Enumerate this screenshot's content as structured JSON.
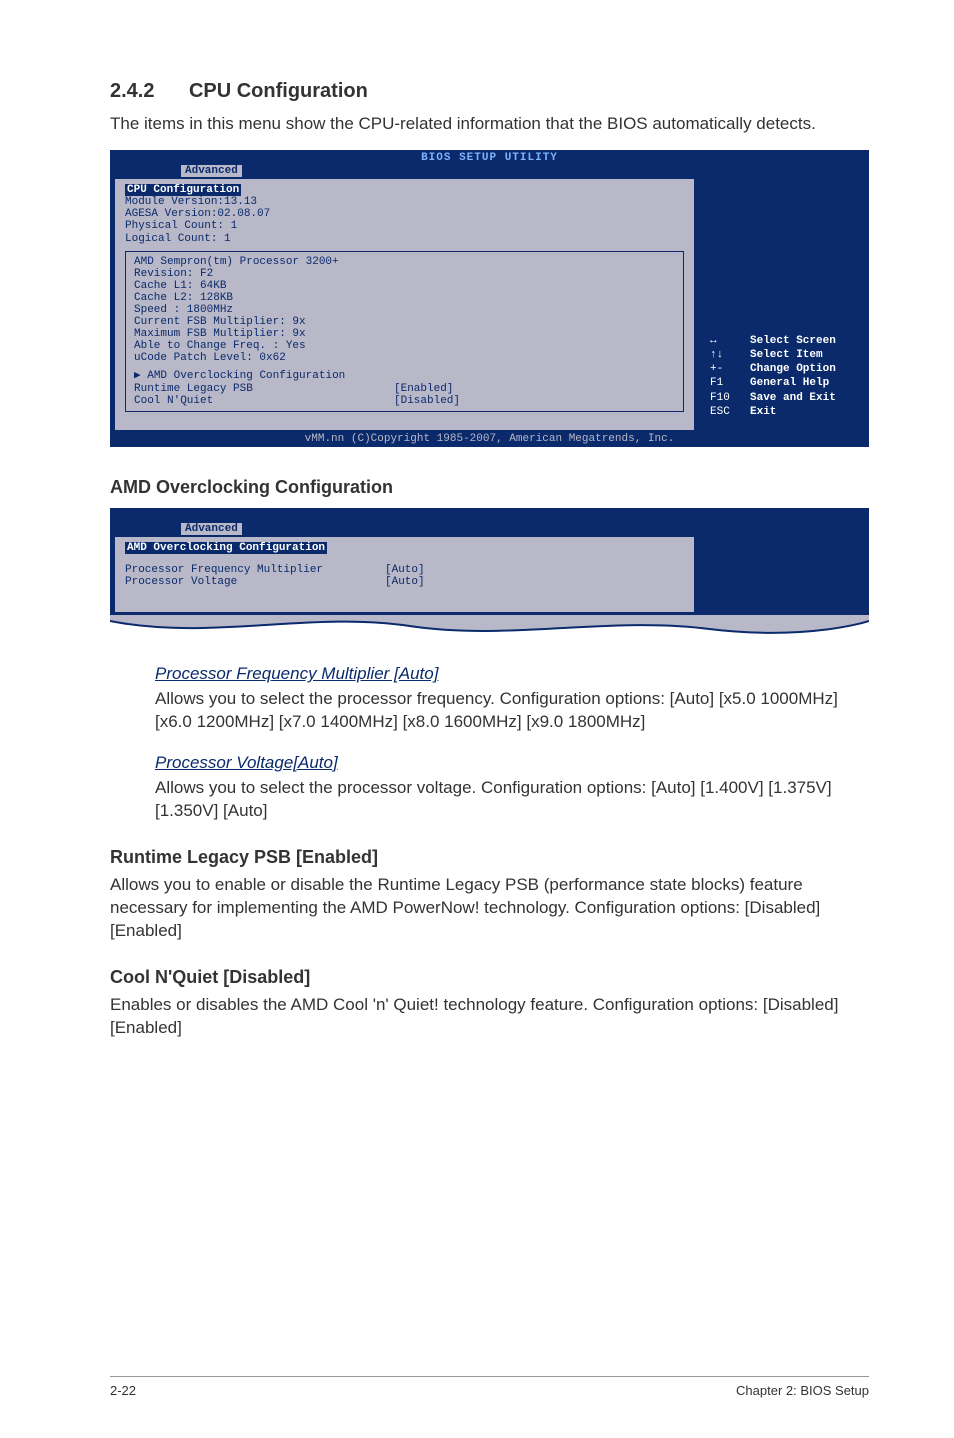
{
  "sectionNumber": "2.4.2",
  "sectionTitle": "CPU Configuration",
  "intro": "The items in this menu show the CPU-related information that the BIOS automatically detects.",
  "bios1": {
    "title": "BIOS SETUP UTILITY",
    "tab": "Advanced",
    "header": "CPU Configuration",
    "lines": [
      "Module Version:13.13",
      "AGESA Version:02.08.07",
      "Physical Count: 1",
      "Logical Count: 1"
    ],
    "sublines": [
      "AMD Sempron(tm) Processor 3200+",
      "Revision: F2",
      "Cache L1: 64KB",
      "Cache L2: 128KB",
      "Speed   : 1800MHz",
      "Current FSB Multiplier: 9x",
      "Maximum FSB Multiplier: 9x",
      "Able to Change Freq. : Yes",
      "uCode Patch Level: 0x62"
    ],
    "options": [
      {
        "label": "AMD Overclocking Configuration",
        "value": ""
      },
      {
        "label": "Runtime Legacy PSB",
        "value": "[Enabled]"
      },
      {
        "label": "Cool N'Quiet",
        "value": "[Disabled]"
      }
    ],
    "help": [
      {
        "key": "↔",
        "label": "Select Screen"
      },
      {
        "key": "↑↓",
        "label": "Select Item"
      },
      {
        "key": "+-",
        "label": "Change Option"
      },
      {
        "key": "F1",
        "label": "General Help"
      },
      {
        "key": "F10",
        "label": "Save and Exit"
      },
      {
        "key": "ESC",
        "label": "Exit"
      }
    ],
    "footer": "vMM.nn (C)Copyright 1985-2007, American Megatrends, Inc."
  },
  "amdHeading": "AMD Overclocking Configuration",
  "bios2": {
    "title": "BIOS SETUP UTILITY",
    "tab": "Advanced",
    "header": "AMD Overclocking Configuration",
    "rows": [
      {
        "label": "Processor Frequency Multiplier",
        "value": "[Auto]"
      },
      {
        "label": "Processor Voltage",
        "value": "[Auto]"
      }
    ]
  },
  "opt1": {
    "title": "Processor Frequency Multiplier [Auto]",
    "body": "Allows you to select the processor frequency. Configuration options: [Auto] [x5.0 1000MHz] [x6.0 1200MHz] [x7.0 1400MHz] [x8.0 1600MHz] [x9.0 1800MHz]"
  },
  "opt2": {
    "title": "Processor Voltage[Auto]",
    "body": "Allows you to select the processor voltage. Configuration options: [Auto] [1.400V] [1.375V] [1.350V] [Auto]"
  },
  "runtime": {
    "title": "Runtime Legacy PSB [Enabled]",
    "body": "Allows you to enable or disable the Runtime Legacy PSB (performance state blocks) feature necessary for implementing the AMD PowerNow! technology. Configuration options: [Disabled] [Enabled]"
  },
  "cool": {
    "title": "Cool N'Quiet [Disabled]",
    "body": "Enables or disables the AMD Cool 'n' Quiet! technology feature. Configuration options: [Disabled] [Enabled]"
  },
  "footer": {
    "left": "2-22",
    "right": "Chapter 2: BIOS Setup"
  }
}
